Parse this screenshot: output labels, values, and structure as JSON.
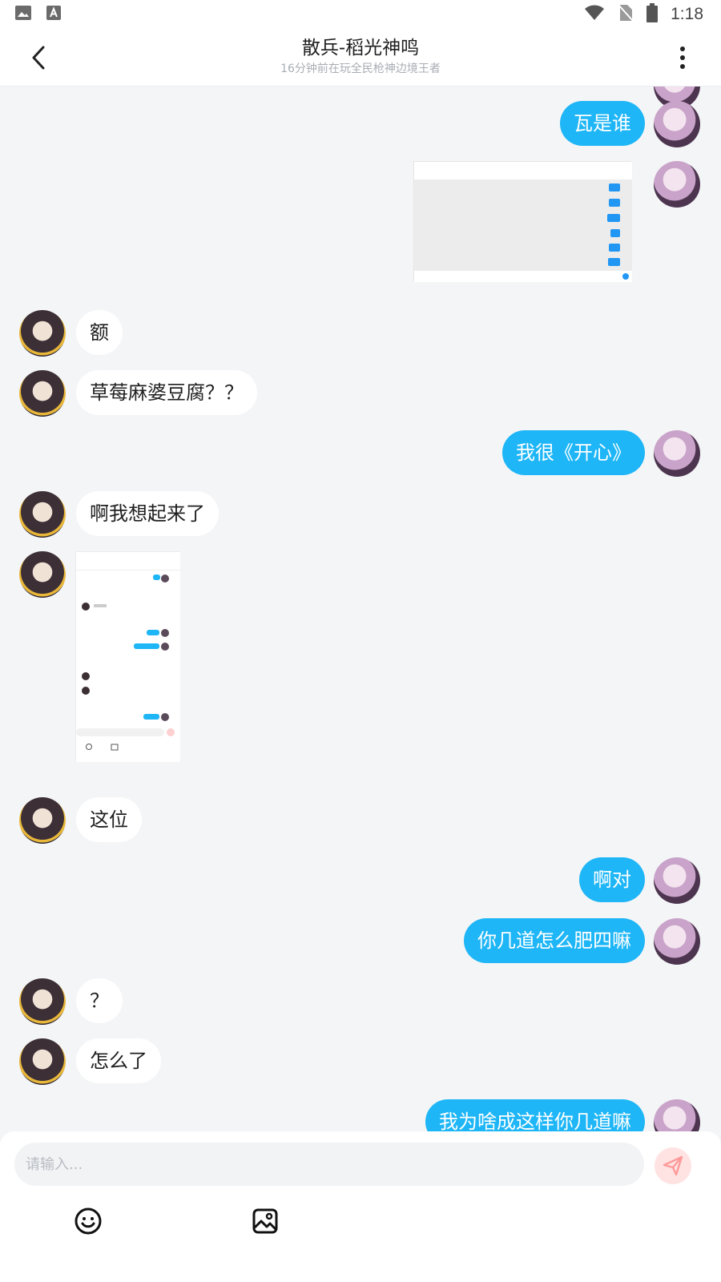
{
  "status_bar": {
    "time": "1:18",
    "left_icons": [
      "image-icon",
      "text-a-icon"
    ],
    "right_icons": [
      "wifi-icon",
      "no-sim-icon",
      "battery-icon"
    ]
  },
  "header": {
    "title": "散兵-稻光神鸣",
    "subtitle": "16分钟前在玩全民枪神边境王者",
    "back_icon": "chevron-left-icon",
    "more_icon": "more-vertical-icon"
  },
  "messages": [
    {
      "from": "me",
      "type": "text",
      "text": "瓦是谁"
    },
    {
      "from": "me",
      "type": "image",
      "content": "screenshot"
    },
    {
      "from": "other",
      "type": "text",
      "text": "额"
    },
    {
      "from": "other",
      "type": "text",
      "text": "草莓麻婆豆腐？？"
    },
    {
      "from": "me",
      "type": "text",
      "text": "我很《开心》"
    },
    {
      "from": "other",
      "type": "text",
      "text": "啊我想起来了"
    },
    {
      "from": "other",
      "type": "image",
      "content": "screenshot"
    },
    {
      "from": "other",
      "type": "text",
      "text": "这位"
    },
    {
      "from": "me",
      "type": "text",
      "text": "啊对"
    },
    {
      "from": "me",
      "type": "text",
      "text": "你几道怎么肥四嘛"
    },
    {
      "from": "other",
      "type": "text",
      "text": "？"
    },
    {
      "from": "other",
      "type": "text",
      "text": "怎么了"
    },
    {
      "from": "me",
      "type": "text",
      "text": "我为啥成这样你几道嘛"
    }
  ],
  "composer": {
    "placeholder": "请输入...",
    "send_icon": "send-icon",
    "tools": [
      "emoji-icon",
      "image-picker-icon"
    ]
  },
  "colors": {
    "accent": "#1eb6f6",
    "background": "#f4f5f7",
    "send_button_bg": "#ffe3e3",
    "send_icon": "#ff9a9a"
  }
}
